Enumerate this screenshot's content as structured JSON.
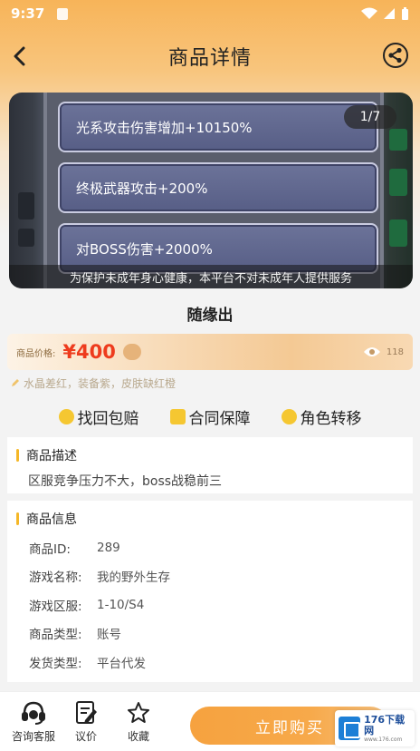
{
  "status_bar": {
    "time": "9:37"
  },
  "header": {
    "title": "商品详情"
  },
  "banner": {
    "stats": [
      "光系攻击伤害增加+10150%",
      "终极武器攻击+200%",
      "对BOSS伤害+2000%"
    ],
    "counter": "1/7",
    "notice": "为保护未成年身心健康，本平台不对未成年人提供服务"
  },
  "product": {
    "title": "随缘出",
    "price_label": "商品价格:",
    "price": "¥400",
    "price_tag": "",
    "views": "118",
    "tags_line": "水晶差红，装备紫，皮肤缺红橙"
  },
  "guarantees": [
    "找回包赔",
    "合同保障",
    "角色转移"
  ],
  "description": {
    "title": "商品描述",
    "text": "区服竞争压力不大，boss战稳前三"
  },
  "info": {
    "title": "商品信息",
    "rows": [
      {
        "key": "商品ID:",
        "value": "289"
      },
      {
        "key": "游戏名称:",
        "value": "我的野外生存"
      },
      {
        "key": "游戏区服:",
        "value": "1-10/S4"
      },
      {
        "key": "商品类型:",
        "value": "账号"
      },
      {
        "key": "发货类型:",
        "value": "平台代发"
      }
    ]
  },
  "bottom_bar": {
    "service_label": "咨询客服",
    "bargain_label": "议价",
    "favorite_label": "收藏",
    "buy_label": "立即购买"
  },
  "watermark": {
    "text": "176下载网",
    "sub": "www.176.com"
  },
  "colors": {
    "accent": "#f5b727",
    "price": "#ee3b1d",
    "buy": "#f6a23f"
  }
}
